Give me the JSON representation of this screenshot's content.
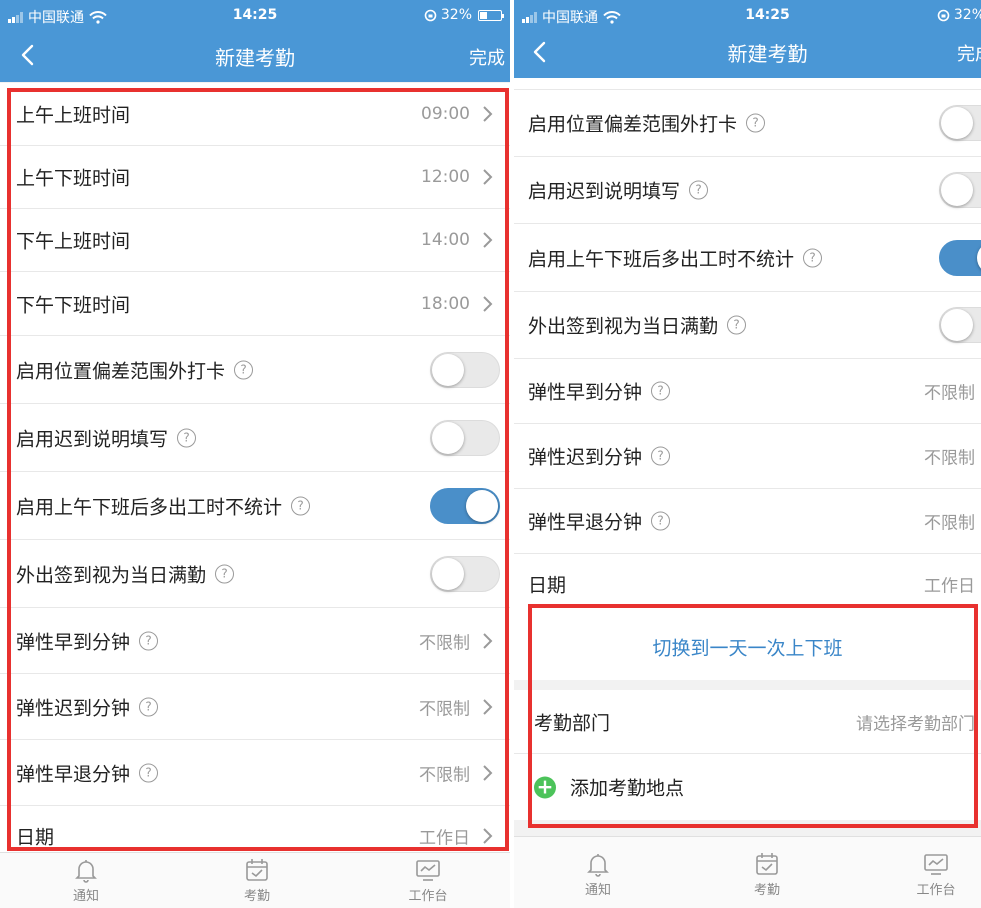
{
  "status": {
    "carrier": "中国联通",
    "time": "14:25",
    "battery": "32%"
  },
  "nav": {
    "title": "新建考勤",
    "done": "完成"
  },
  "left": {
    "time_rows": [
      {
        "label": "上午上班时间",
        "value": "09:00"
      },
      {
        "label": "上午下班时间",
        "value": "12:00"
      },
      {
        "label": "下午上班时间",
        "value": "14:00"
      },
      {
        "label": "下午下班时间",
        "value": "18:00"
      }
    ],
    "toggle_rows": [
      {
        "label": "启用位置偏差范围外打卡",
        "on": false
      },
      {
        "label": "启用迟到说明填写",
        "on": false
      },
      {
        "label": "启用上午下班后多出工时不统计",
        "on": true
      },
      {
        "label": "外出签到视为当日满勤",
        "on": false
      }
    ],
    "minute_rows": [
      {
        "label": "弹性早到分钟",
        "value": "不限制"
      },
      {
        "label": "弹性迟到分钟",
        "value": "不限制"
      },
      {
        "label": "弹性早退分钟",
        "value": "不限制"
      }
    ],
    "date_row": {
      "label": "日期",
      "value": "工作日"
    }
  },
  "right": {
    "toggle_rows": [
      {
        "label": "启用位置偏差范围外打卡",
        "on": false
      },
      {
        "label": "启用迟到说明填写",
        "on": false
      },
      {
        "label": "启用上午下班后多出工时不统计",
        "on": true
      },
      {
        "label": "外出签到视为当日满勤",
        "on": false
      }
    ],
    "minute_rows": [
      {
        "label": "弹性早到分钟",
        "value": "不限制"
      },
      {
        "label": "弹性迟到分钟",
        "value": "不限制"
      },
      {
        "label": "弹性早退分钟",
        "value": "不限制"
      }
    ],
    "date_row": {
      "label": "日期",
      "value": "工作日"
    },
    "switch_mode": "切换到一天一次上下班",
    "department": {
      "label": "考勤部门",
      "placeholder": "请选择考勤部门"
    },
    "add_location": "添加考勤地点"
  },
  "tabs": [
    "通知",
    "考勤",
    "工作台"
  ],
  "colors": {
    "header": "#4a97d6",
    "accent": "#3a86c8",
    "highlight_border": "#e8312f",
    "toggle_on": "#4a8fc9",
    "add_icon": "#4cc35a"
  },
  "icons": {
    "back": "chevron-left-icon",
    "row_arrow": "chevron-right-icon",
    "help": "question-circle-icon",
    "notify": "bell-icon",
    "attendance": "calendar-check-icon",
    "workbench": "monitor-chart-icon",
    "add": "plus-circle-icon"
  }
}
